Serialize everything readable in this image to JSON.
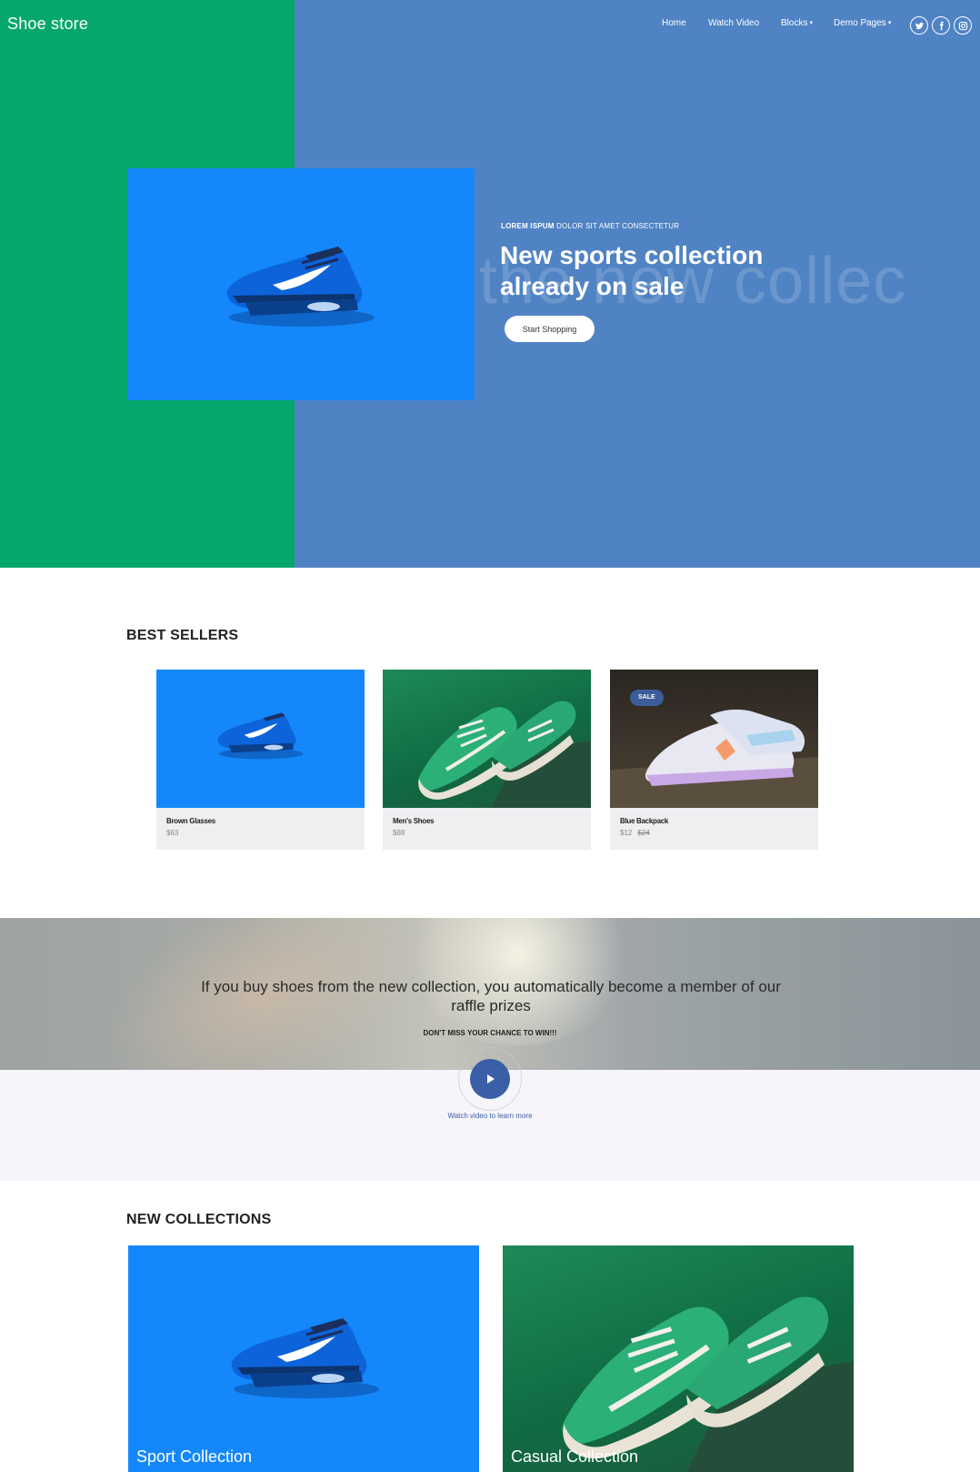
{
  "header": {
    "brand": "Shoe store",
    "nav": [
      {
        "label": "Home"
      },
      {
        "label": "Watch Video"
      },
      {
        "label": "Blocks"
      },
      {
        "label": "Demo Pages"
      }
    ],
    "social": [
      "twitter-icon",
      "facebook-icon",
      "instagram-icon"
    ]
  },
  "hero": {
    "eyebrow_bold": "LOREM ISPUM",
    "eyebrow_rest": " DOLOR SIT AMET CONSECTETUR",
    "title_line1": "New sports collection",
    "title_line2": "already on sale",
    "background_text": "the new collec",
    "cta": "Start Shopping"
  },
  "best_sellers": {
    "heading": "BEST SELLERS",
    "products": [
      {
        "name": "Brown Glasses",
        "price": "$63",
        "old_price": "",
        "badge": ""
      },
      {
        "name": "Men's Shoes",
        "price": "$88",
        "old_price": "",
        "badge": ""
      },
      {
        "name": "Blue Backpack",
        "price": "$12",
        "old_price": "$24",
        "badge": "SALE"
      }
    ]
  },
  "promo": {
    "text": "If you buy shoes from the new collection, you automatically become a member of our raffle prizes",
    "subtext": "DON'T MISS YOUR CHANCE TO WIN!!!",
    "video_link": "Watch video to learn more"
  },
  "new_collections": {
    "heading": "NEW COLLECTIONS",
    "items": [
      {
        "label": "Sport Collection"
      },
      {
        "label": "Casual Collection"
      }
    ]
  },
  "colors": {
    "hero_blue": "#5083c4",
    "hero_green": "#05a86a",
    "shoe_bg": "#1488fb",
    "accent": "#3a5fa6"
  }
}
